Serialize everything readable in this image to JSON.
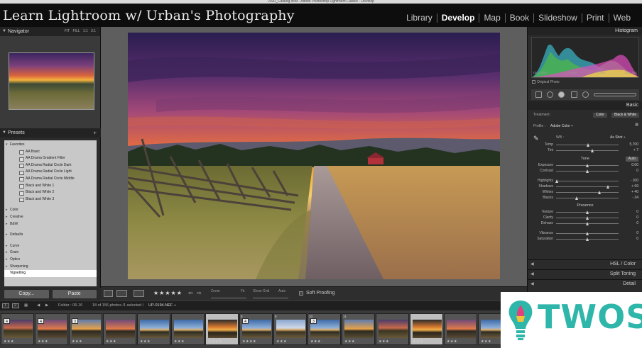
{
  "window": {
    "title": "2020_Catalog.lrcat - Adobe Photoshop Lightroom Classic - Develop"
  },
  "identity_plate": "Learn Lightroom w/ Urban's Photography",
  "modules": [
    {
      "label": "Library",
      "active": false
    },
    {
      "label": "Develop",
      "active": true
    },
    {
      "label": "Map",
      "active": false
    },
    {
      "label": "Book",
      "active": false
    },
    {
      "label": "Slideshow",
      "active": false
    },
    {
      "label": "Print",
      "active": false
    },
    {
      "label": "Web",
      "active": false
    }
  ],
  "left_panel": {
    "navigator": {
      "title": "Navigator",
      "zoom_options": "FIT  FILL  1:1  3:1"
    },
    "presets": {
      "title": "Presets",
      "add_symbol": "+",
      "items": [
        {
          "label": "Favorites",
          "kind": "open"
        },
        {
          "label": "AA Basic",
          "kind": "sub"
        },
        {
          "label": "AA Drama Gradient Filter",
          "kind": "sub"
        },
        {
          "label": "AA Drama Radial Circle Dark",
          "kind": "sub"
        },
        {
          "label": "AA Drama Radial Circle Light",
          "kind": "sub"
        },
        {
          "label": "AA Drama Radial Circle Middle",
          "kind": "sub"
        },
        {
          "label": "Black and White 1",
          "kind": "sub"
        },
        {
          "label": "Black and White 2",
          "kind": "sub"
        },
        {
          "label": "Black and White 3",
          "kind": "sub"
        },
        {
          "label": "",
          "kind": "gap"
        },
        {
          "label": "Color",
          "kind": "folder"
        },
        {
          "label": "Creative",
          "kind": "folder"
        },
        {
          "label": "B&W",
          "kind": "folder"
        },
        {
          "label": "",
          "kind": "gap"
        },
        {
          "label": "Defaults",
          "kind": "folder"
        },
        {
          "label": "",
          "kind": "gap"
        },
        {
          "label": "Curve",
          "kind": "folder"
        },
        {
          "label": "Grain",
          "kind": "folder"
        },
        {
          "label": "Optics",
          "kind": "folder"
        },
        {
          "label": "Sharpening",
          "kind": "folder"
        },
        {
          "label": "Vignetting",
          "kind": "sel"
        }
      ]
    },
    "copy_button": "Copy...",
    "paste_button": "Paste"
  },
  "toolbar": {
    "stars": "★★★★★",
    "zoom_label": "Zoom",
    "fit_label": "Fit",
    "show_grid_label": "Show Grid",
    "auto_label": "Auto",
    "soft_proofing_label": "Soft Proofing"
  },
  "right_panel": {
    "histogram_title": "Histogram",
    "histogram_meta": [
      "ISO 1600",
      "70 mm",
      "f / 8.0",
      "1/30 sec"
    ],
    "original_photo_label": "Original Photo",
    "basic_title": "Basic",
    "treatment_label": "Treatment :",
    "treatment_color": "Color",
    "treatment_bw": "Black & White",
    "profile_label": "Profile :",
    "profile_value": "Adobe Color ÷",
    "wb_label": "WB :",
    "wb_value": "As Shot ÷",
    "tone_label": "Tone",
    "auto_button": "Auto",
    "presence_label": "Presence",
    "sliders_wb": [
      {
        "label": "Temp",
        "value": "5,700",
        "pos": 0.52
      },
      {
        "label": "Tint",
        "value": "+ 7",
        "pos": 0.58
      }
    ],
    "sliders_tone": [
      {
        "label": "Exposure",
        "value": "0.00",
        "pos": 0.5
      },
      {
        "label": "Contrast",
        "value": "0",
        "pos": 0.5
      },
      {
        "label": "",
        "value": "",
        "pos": -1
      },
      {
        "label": "Highlights",
        "value": "- 100",
        "pos": 0.02
      },
      {
        "label": "Shadows",
        "value": "+ 69",
        "pos": 0.84
      },
      {
        "label": "Whites",
        "value": "+ 40",
        "pos": 0.7
      },
      {
        "label": "Blacks",
        "value": "- 34",
        "pos": 0.33
      }
    ],
    "sliders_presence": [
      {
        "label": "Texture",
        "value": "0",
        "pos": 0.5
      },
      {
        "label": "Clarity",
        "value": "0",
        "pos": 0.5
      },
      {
        "label": "Dehaze",
        "value": "0",
        "pos": 0.5
      },
      {
        "label": "",
        "value": "",
        "pos": -1
      },
      {
        "label": "Vibrance",
        "value": "0",
        "pos": 0.5
      },
      {
        "label": "Saturation",
        "value": "0",
        "pos": 0.5
      }
    ],
    "hsl_title": "HSL / Color",
    "split_toning_title": "Split Toning",
    "detail_title": "Detail"
  },
  "filmstrip_bar": {
    "page_1": "1",
    "page_2": "2",
    "folder_text": "Folder : 06-16",
    "count_text": "18 of 156 photos /1 selected /",
    "filename": "UP-0194.NEF ÷"
  },
  "filmstrip": {
    "cells": [
      {
        "num": "",
        "badge": "4",
        "dots": "★★★",
        "selected": false,
        "palette": "a"
      },
      {
        "num": "",
        "badge": "4",
        "dots": "★★★",
        "selected": false,
        "palette": "b"
      },
      {
        "num": "",
        "badge": "3",
        "dots": "★★★",
        "selected": false,
        "palette": "c"
      },
      {
        "num": "",
        "badge": "",
        "dots": "★★★",
        "selected": false,
        "palette": "b"
      },
      {
        "num": "",
        "badge": "",
        "dots": "★★★",
        "selected": false,
        "palette": "d"
      },
      {
        "num": "",
        "badge": "",
        "dots": "★★★",
        "selected": false,
        "palette": "d"
      },
      {
        "num": "7",
        "badge": "",
        "dots": "★★★★",
        "selected": true,
        "palette": "e"
      },
      {
        "num": "8",
        "badge": "4",
        "dots": "★★★★",
        "selected": false,
        "palette": "d"
      },
      {
        "num": "9",
        "badge": "",
        "dots": "★★★",
        "selected": false,
        "palette": "f"
      },
      {
        "num": "10",
        "badge": "3",
        "dots": "★★★",
        "selected": false,
        "palette": "d"
      },
      {
        "num": "11",
        "badge": "",
        "dots": "★★★",
        "selected": false,
        "palette": "c"
      },
      {
        "num": "",
        "badge": "",
        "dots": "★★★",
        "selected": false,
        "palette": "a"
      },
      {
        "num": "",
        "badge": "",
        "dots": "★★★",
        "selected": true,
        "palette": "e"
      },
      {
        "num": "",
        "badge": "",
        "dots": "★★★",
        "selected": false,
        "palette": "b"
      },
      {
        "num": "",
        "badge": "",
        "dots": "★★★",
        "selected": false,
        "palette": "d"
      }
    ]
  },
  "watermark": {
    "text": "TWOS",
    "color": "#2fb6aa"
  }
}
